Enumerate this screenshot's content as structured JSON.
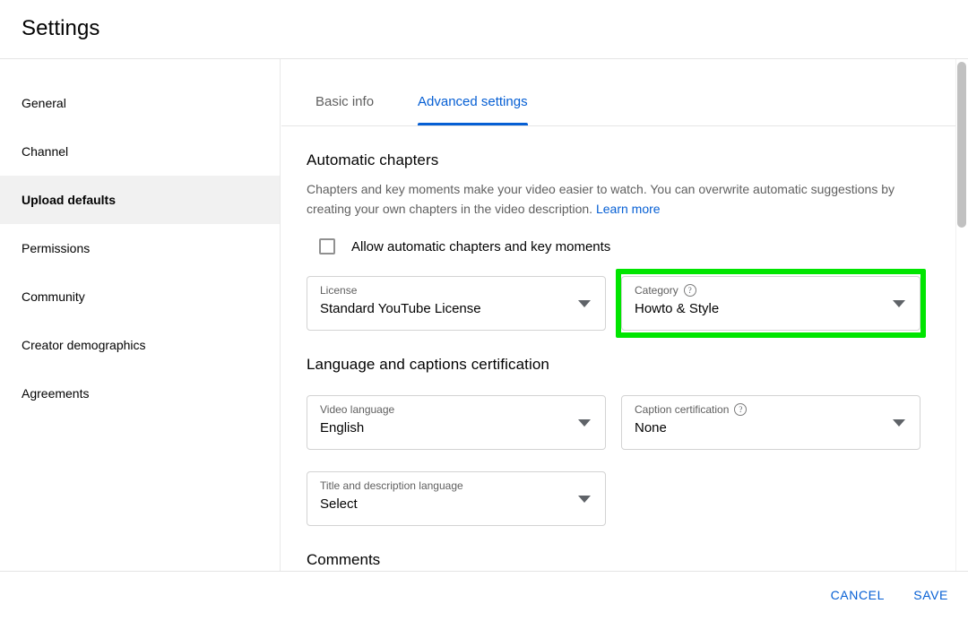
{
  "header": {
    "title": "Settings"
  },
  "sidebar": {
    "items": [
      {
        "label": "General",
        "active": false
      },
      {
        "label": "Channel",
        "active": false
      },
      {
        "label": "Upload defaults",
        "active": true
      },
      {
        "label": "Permissions",
        "active": false
      },
      {
        "label": "Community",
        "active": false
      },
      {
        "label": "Creator demographics",
        "active": false
      },
      {
        "label": "Agreements",
        "active": false
      }
    ]
  },
  "main": {
    "tabs": [
      {
        "label": "Basic info",
        "active": false
      },
      {
        "label": "Advanced settings",
        "active": true
      }
    ],
    "automatic_chapters": {
      "title": "Automatic chapters",
      "description": "Chapters and key moments make your video easier to watch. You can overwrite automatic suggestions by creating your own chapters in the video description.",
      "learn_more": "Learn more",
      "checkbox_label": "Allow automatic chapters and key moments",
      "checkbox_checked": false
    },
    "license_row": {
      "license": {
        "label": "License",
        "value": "Standard YouTube License",
        "has_help": false
      },
      "category": {
        "label": "Category",
        "value": "Howto & Style",
        "has_help": true,
        "highlighted": true,
        "highlight_color": "#00e500"
      }
    },
    "language_section": {
      "title": "Language and captions certification",
      "video_language": {
        "label": "Video language",
        "value": "English",
        "has_help": false
      },
      "caption_certification": {
        "label": "Caption certification",
        "value": "None",
        "has_help": true
      },
      "title_description_language": {
        "label": "Title and description language",
        "value": "Select",
        "has_help": false
      }
    },
    "comments": {
      "title": "Comments"
    }
  },
  "footer": {
    "cancel_label": "Cancel",
    "save_label": "Save"
  },
  "icons": {
    "help": "?",
    "chevron_down": "chevron-down-icon"
  },
  "colors": {
    "accent_blue": "#065fd4",
    "highlight_green": "#00e500",
    "sidebar_active_bg": "#f1f1f1"
  }
}
